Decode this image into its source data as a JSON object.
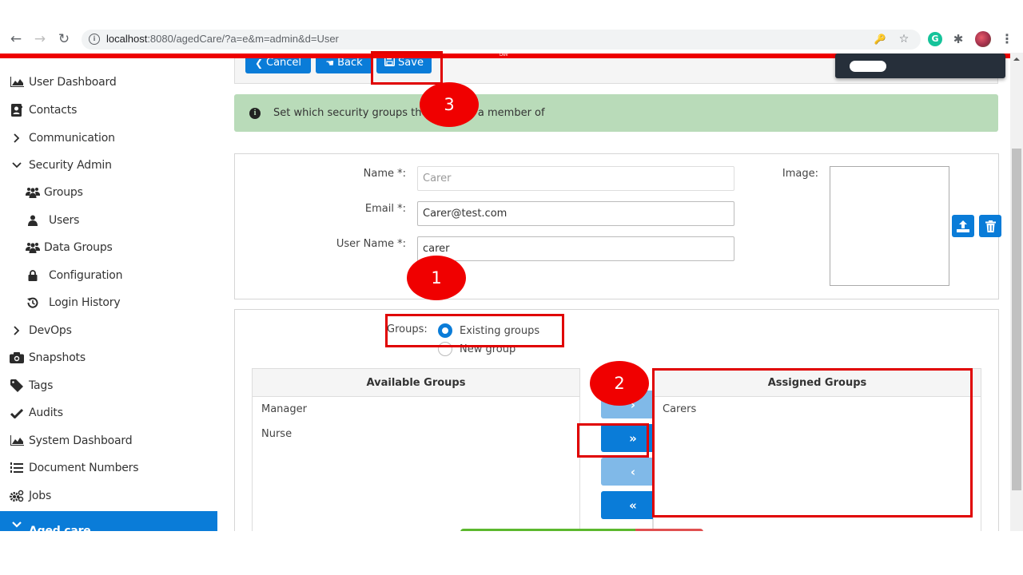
{
  "browser": {
    "url_host": "localhost",
    "url_rest": ":8080/agedCare/?a=e&m=admin&d=User",
    "env_label": "Dev",
    "icons": [
      "back-icon",
      "forward-icon",
      "reload-icon",
      "info-icon",
      "key-icon",
      "star-icon",
      "grammarly-icon",
      "extensions-icon",
      "profile-avatar",
      "menu-icon"
    ]
  },
  "sidebar": {
    "items": [
      {
        "label": "User Dashboard",
        "icon": "area-chart-icon"
      },
      {
        "label": "Contacts",
        "icon": "contact-card-icon"
      },
      {
        "label": "Communication",
        "icon": "chevron-right-icon"
      },
      {
        "label": "Security Admin",
        "icon": "chevron-down-icon"
      },
      {
        "label": "Groups",
        "icon": "users-icon"
      },
      {
        "label": "Users",
        "icon": "user-icon"
      },
      {
        "label": "Data Groups",
        "icon": "users-icon"
      },
      {
        "label": "Configuration",
        "icon": "lock-icon"
      },
      {
        "label": "Login History",
        "icon": "history-icon"
      },
      {
        "label": "DevOps",
        "icon": "chevron-right-icon"
      },
      {
        "label": "Snapshots",
        "icon": "camera-icon"
      },
      {
        "label": "Tags",
        "icon": "tag-icon"
      },
      {
        "label": "Audits",
        "icon": "check-icon"
      },
      {
        "label": "System Dashboard",
        "icon": "area-chart-icon"
      },
      {
        "label": "Document Numbers",
        "icon": "numbered-list-icon"
      },
      {
        "label": "Jobs",
        "icon": "cogs-icon"
      },
      {
        "label": "Aged care",
        "icon": "chevron-down-icon",
        "active": true
      }
    ]
  },
  "actions": {
    "cancel": "Cancel",
    "back": "Back",
    "save": "Save"
  },
  "alert": {
    "text_before": "Set which security groups the u",
    "text_after": "a member of"
  },
  "form": {
    "name_label": "Name *:",
    "name_value": "Carer",
    "email_label": "Email *:",
    "email_value": "Carer@test.com",
    "username_label": "User Name *:",
    "username_value": "carer",
    "image_label": "Image:"
  },
  "groups": {
    "label": "Groups:",
    "options": [
      {
        "label": "Existing groups",
        "checked": true
      },
      {
        "label": "New group",
        "checked": false
      }
    ],
    "available_header": "Available Groups",
    "available": [
      "Manager",
      "Nurse"
    ],
    "assigned_header": "Assigned Groups",
    "assigned": [
      "Carers"
    ],
    "buttons": {
      "move_right": "›",
      "move_all_right": "»",
      "move_left": "‹",
      "move_all_left": "«"
    }
  },
  "status_bar": {
    "ok_fraction": 0.72,
    "fail_fraction": 0.28,
    "ok_color": "#5cb82e",
    "fail_color": "#e05050"
  },
  "annotations": [
    {
      "number": "1",
      "target": "user-name-field"
    },
    {
      "number": "2",
      "target": "move-all-right-button"
    },
    {
      "number": "3",
      "target": "save-button"
    }
  ],
  "colors": {
    "primary": "#0a7cd8",
    "primary_disabled": "#80b9e8",
    "alert_bg": "#b9dbb9",
    "env_bar": "#ee0000",
    "annotation": "#f00000"
  }
}
